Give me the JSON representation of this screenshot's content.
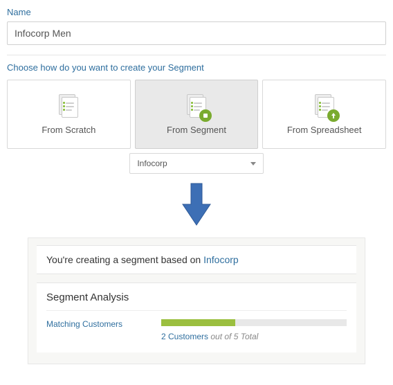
{
  "form": {
    "name_label": "Name",
    "name_value": "Infocorp Men",
    "choose_label": "Choose how do you want to create your Segment"
  },
  "options": {
    "scratch": "From Scratch",
    "segment": "From Segment",
    "spreadsheet": "From Spreadsheet",
    "selected": "segment"
  },
  "dropdown": {
    "selected": "Infocorp"
  },
  "result": {
    "info_prefix": "You're creating a segment based on ",
    "info_link": "Infocorp",
    "analysis_title": "Segment Analysis",
    "metric_label": "Matching Customers",
    "matching": 2,
    "total": 5,
    "caption_customers": "2 Customers",
    "caption_outof": " out of 5 Total"
  },
  "colors": {
    "accent": "#2e6e9e",
    "green": "#9bbf3f",
    "arrow": "#3d6fb5"
  }
}
